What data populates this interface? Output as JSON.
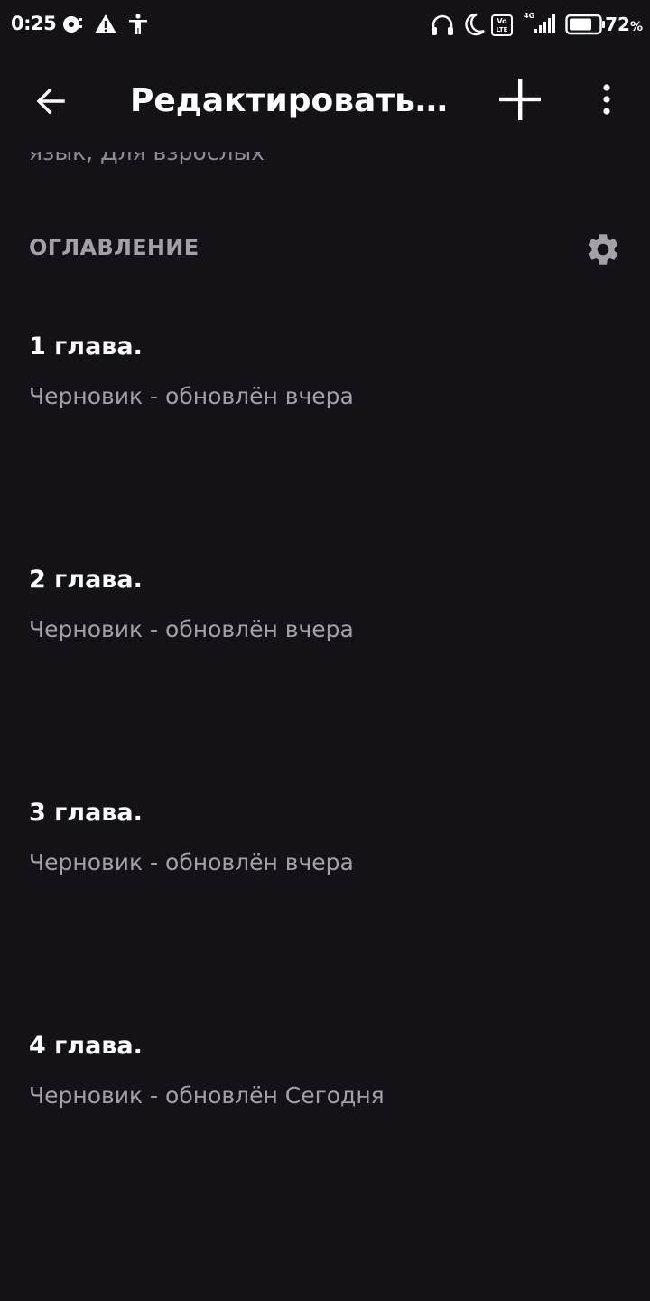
{
  "status_bar": {
    "time": "0:25",
    "battery_percent": "72",
    "battery_sign": "%",
    "network_label": "4G",
    "volte_label": "Vo LTE"
  },
  "toolbar": {
    "title": "Редактировать и...",
    "back_icon": "arrow-left-icon",
    "add_icon": "plus-icon",
    "more_icon": "more-vertical-icon"
  },
  "content": {
    "tags_line": "язык, Для взрослых",
    "section_title": "ОГЛАВЛЕНИЕ",
    "settings_icon": "gear-icon",
    "chapters": [
      {
        "title": "1 глава.",
        "status": "Черновик - обновлён вчера"
      },
      {
        "title": "2 глава.",
        "status": "Черновик - обновлён вчера"
      },
      {
        "title": "3 глава.",
        "status": "Черновик - обновлён вчера"
      },
      {
        "title": "4 глава.",
        "status": "Черновик - обновлён Сегодня"
      }
    ]
  },
  "colors": {
    "background": "#141216",
    "text_primary": "#ffffff",
    "text_secondary": "#a3a0a8"
  }
}
